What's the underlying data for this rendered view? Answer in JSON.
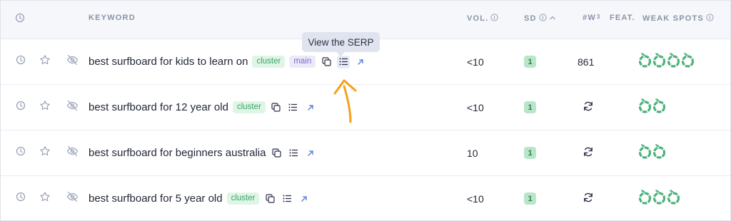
{
  "header": {
    "keyword": "KEYWORD",
    "vol": "VOL.",
    "sd": "SD",
    "w3": "#W",
    "w3_sup": "3",
    "feat": "FEAT.",
    "weak_spots": "WEAK SPOTS"
  },
  "tooltip": {
    "text": "View the SERP"
  },
  "rows": [
    {
      "keyword": "best surfboard for kids to learn on",
      "tag1": "cluster",
      "tag2": "main",
      "vol": "<10",
      "sd": "1",
      "w3": "861",
      "weak_count": 4
    },
    {
      "keyword": "best surfboard for 12 year old",
      "tag1": "cluster",
      "vol": "<10",
      "sd": "1",
      "w3": "",
      "weak_count": 2
    },
    {
      "keyword": "best surfboard for beginners australia",
      "vol": "10",
      "sd": "1",
      "w3": "",
      "weak_count": 2
    },
    {
      "keyword": "best surfboard for 5 year old",
      "tag1": "cluster",
      "vol": "<10",
      "sd": "1",
      "w3": "",
      "weak_count": 3
    }
  ],
  "colors": {
    "accent_green": "#3aa466",
    "weak_spot_green": "#4db27c",
    "arrow_orange": "#f5a01a",
    "header_text": "#8a93a8"
  },
  "icons": [
    "clock-icon",
    "star-icon",
    "eye-off-icon",
    "copy-icon",
    "list-icon",
    "external-link-icon",
    "refresh-icon",
    "info-icon",
    "sort-up-icon",
    "weak-spot-icon"
  ]
}
